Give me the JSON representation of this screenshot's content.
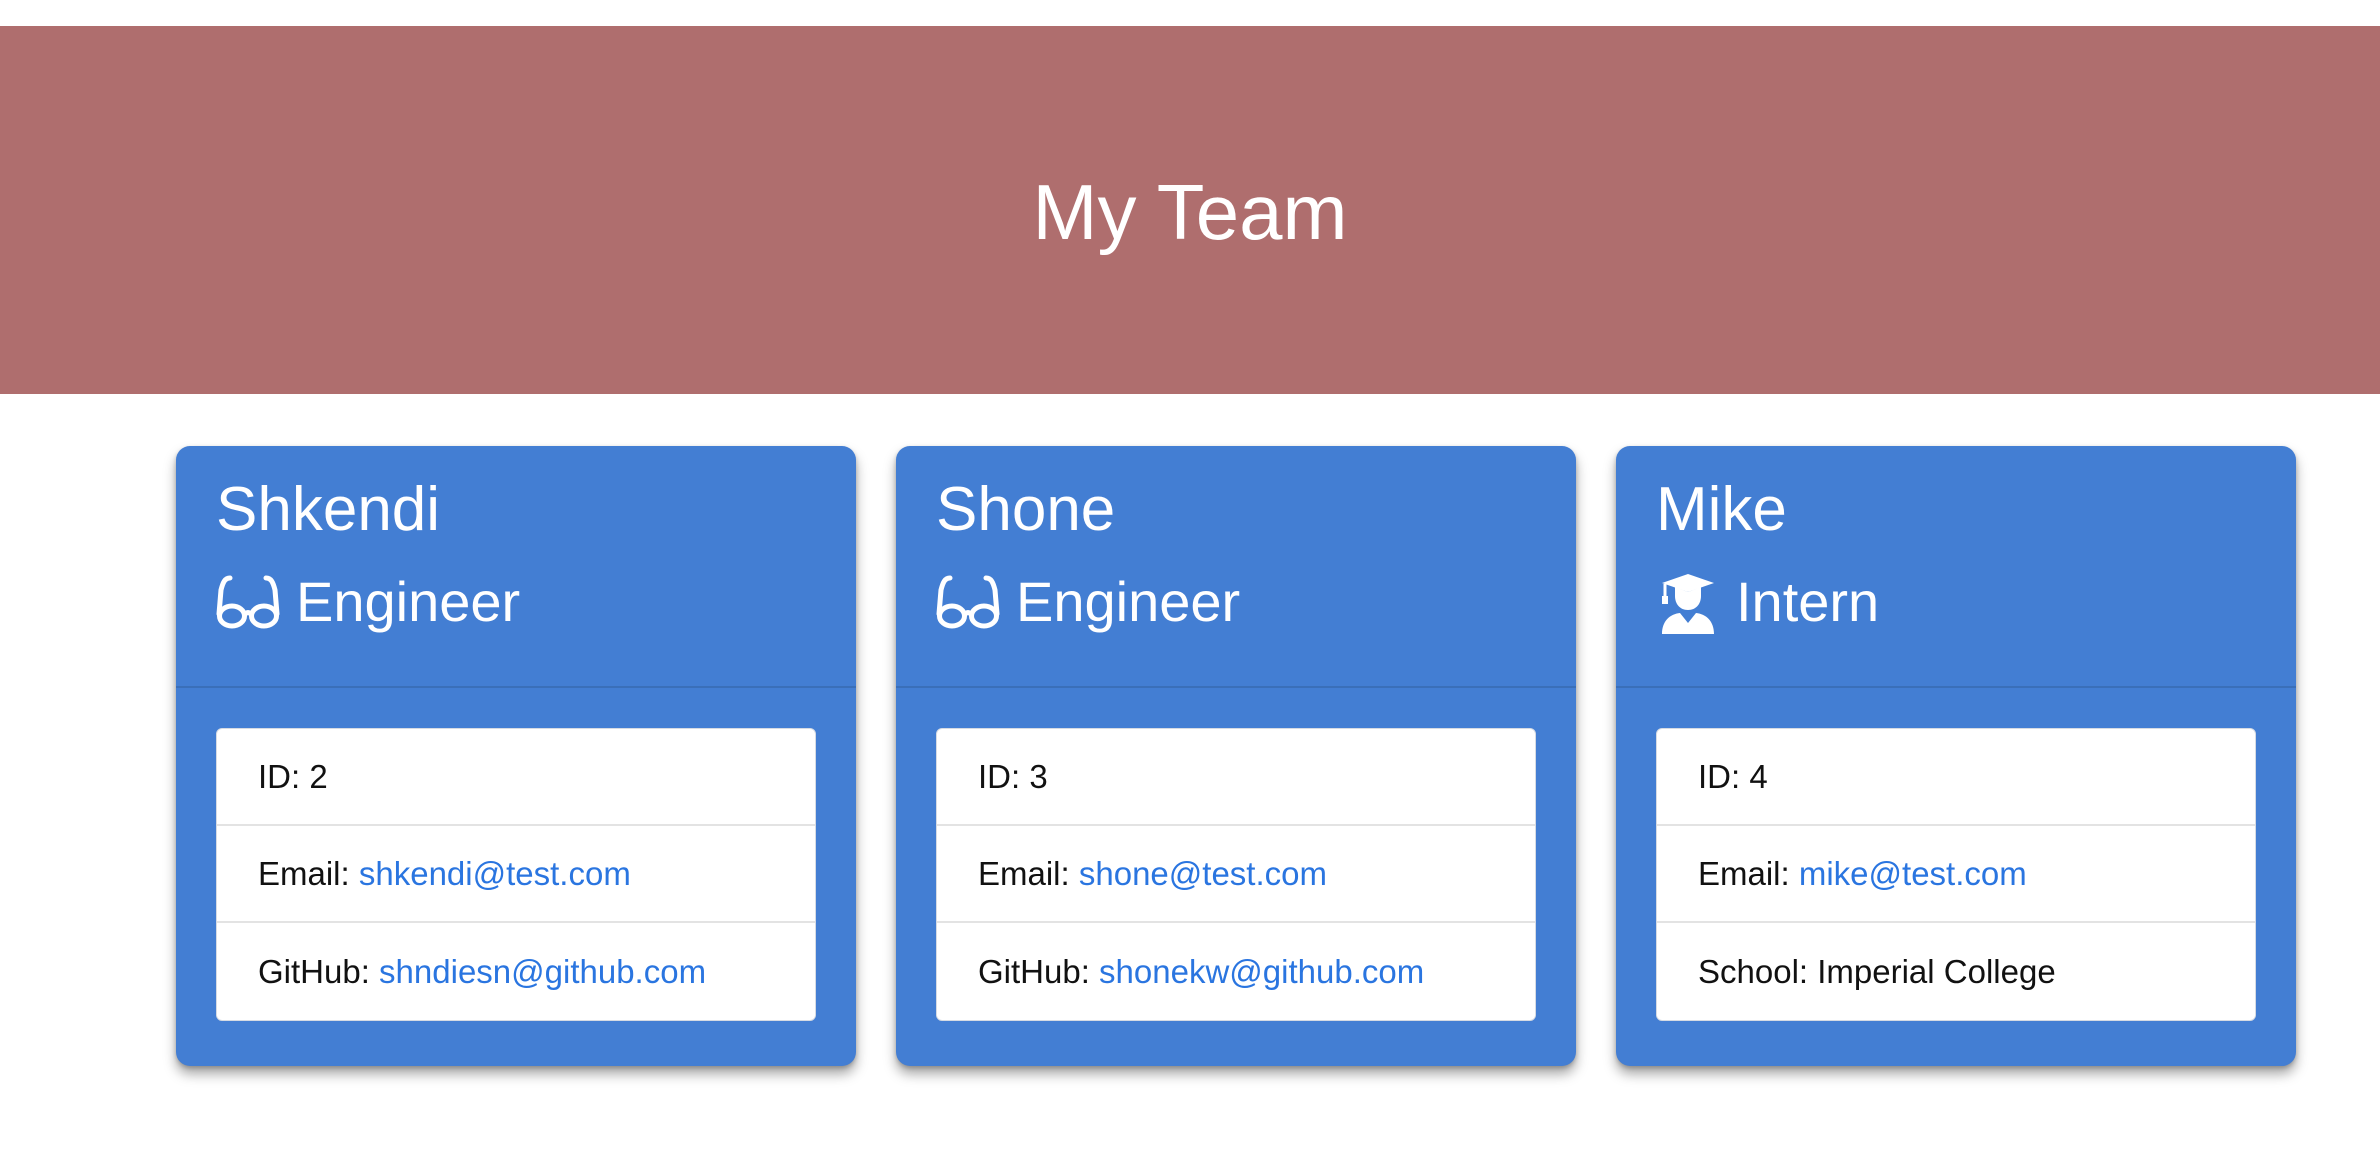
{
  "header": {
    "title": "My Team"
  },
  "cards": [
    {
      "name": "Shkendi",
      "role": "Engineer",
      "icon": "glasses-icon",
      "id_label": "ID: ",
      "id": "2",
      "email_label": "Email: ",
      "email": "shkendi@test.com",
      "extra_label": "GitHub: ",
      "extra_value": "shndiesn@github.com"
    },
    {
      "name": "Shone",
      "role": "Engineer",
      "icon": "glasses-icon",
      "id_label": "ID: ",
      "id": "3",
      "email_label": "Email: ",
      "email": "shone@test.com",
      "extra_label": "GitHub: ",
      "extra_value": "shonekw@github.com"
    },
    {
      "name": "Mike",
      "role": "Intern",
      "icon": "graduate-icon",
      "id_label": "ID: ",
      "id": "4",
      "email_label": "Email: ",
      "email": "mike@test.com",
      "extra_label": "School: ",
      "extra_value": "Imperial College"
    }
  ],
  "colors": {
    "banner": "#af6e6e",
    "card": "#437ed3",
    "link": "#2a75e0"
  }
}
